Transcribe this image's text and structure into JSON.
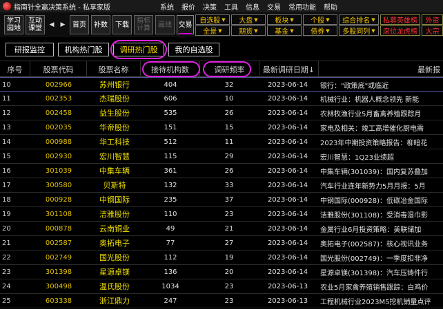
{
  "app": {
    "title": "指南针全赢决策系统 - 私享家版"
  },
  "menu": [
    "系统",
    "报价",
    "决策",
    "工具",
    "信息",
    "交易",
    "常用功能",
    "帮助"
  ],
  "toolbar": {
    "study_line1": "学习",
    "study_line2": "园地",
    "interact_line1": "互动",
    "interact_line2": "课堂",
    "home": "首页",
    "supplement": "补数",
    "download": "下载",
    "indicator_line1": "指标",
    "indicator_line2": "计算",
    "draw": "画线",
    "trade": "交易",
    "quick_row1": [
      "自选股",
      "大盘",
      "板块",
      "个股",
      "综合排名",
      "私募英雄榜",
      "外资"
    ],
    "quick_row2": [
      "全景",
      "期货",
      "基金",
      "债券",
      "多股同列",
      "席位龙虎榜",
      "大宗"
    ]
  },
  "tabs": [
    "研报监控",
    "机构热门股",
    "调研热门股",
    "我的自选股"
  ],
  "table": {
    "headers": [
      "序号",
      "股票代码",
      "股票名称",
      "接待机构数",
      "调研频率",
      "最新调研日期↓",
      "最新报"
    ],
    "rows": [
      {
        "no": "10",
        "code": "002966",
        "name": "苏州银行",
        "inst": "404",
        "freq": "32",
        "date": "2023-06-14",
        "report": "银行：\"政策底\"或临近"
      },
      {
        "no": "11",
        "code": "002353",
        "name": "杰瑞股份",
        "inst": "606",
        "freq": "10",
        "date": "2023-06-14",
        "report": "机械行业：机器人概念领先 新能"
      },
      {
        "no": "12",
        "code": "002458",
        "name": "益生股份",
        "inst": "535",
        "freq": "26",
        "date": "2023-06-14",
        "report": "农林牧渔行业5月畜禽养殖跟踪月"
      },
      {
        "no": "13",
        "code": "002035",
        "name": "华帝股份",
        "inst": "151",
        "freq": "15",
        "date": "2023-06-14",
        "report": "家电及相关：竣工高增催化厨电需"
      },
      {
        "no": "14",
        "code": "000988",
        "name": "华工科技",
        "inst": "512",
        "freq": "11",
        "date": "2023-06-14",
        "report": "2023年中期投资策略报告：柳暗花"
      },
      {
        "no": "15",
        "code": "002930",
        "name": "宏川智慧",
        "inst": "115",
        "freq": "29",
        "date": "2023-06-14",
        "report": "宏川智慧：1Q23业绩超"
      },
      {
        "no": "16",
        "code": "301039",
        "name": "中集车辆",
        "inst": "361",
        "freq": "26",
        "date": "2023-06-14",
        "report": "中集车辆(301039)：国内复苏叠加"
      },
      {
        "no": "17",
        "code": "300580",
        "name": "贝斯特",
        "inst": "132",
        "freq": "33",
        "date": "2023-06-14",
        "report": "汽车行业连年新势力5月月报：5月"
      },
      {
        "no": "18",
        "code": "000928",
        "name": "中钢国际",
        "inst": "235",
        "freq": "37",
        "date": "2023-06-14",
        "report": "中钢国际(000928)：低碳冶金国际"
      },
      {
        "no": "19",
        "code": "301108",
        "name": "洁雅股份",
        "inst": "110",
        "freq": "23",
        "date": "2023-06-14",
        "report": "洁雅股份(301108)：受消毒湿巾影"
      },
      {
        "no": "20",
        "code": "000878",
        "name": "云南铜业",
        "inst": "49",
        "freq": "21",
        "date": "2023-06-14",
        "report": "金属行业6月投资策略：美联储加"
      },
      {
        "no": "21",
        "code": "002587",
        "name": "奥拓电子",
        "inst": "77",
        "freq": "27",
        "date": "2023-06-14",
        "report": "奥拓电子(002587)：核心视讯业务"
      },
      {
        "no": "22",
        "code": "002749",
        "name": "国光股份",
        "inst": "112",
        "freq": "19",
        "date": "2023-06-14",
        "report": "国光股份(002749)：一季度扣非净"
      },
      {
        "no": "23",
        "code": "301398",
        "name": "星源卓镁",
        "inst": "136",
        "freq": "20",
        "date": "2023-06-14",
        "report": "星源卓镁(301398)：汽车压铸件行"
      },
      {
        "no": "24",
        "code": "300498",
        "name": "温氏股份",
        "inst": "1034",
        "freq": "23",
        "date": "2023-06-13",
        "report": "农业5月家禽养殖销售跟踪：白鸡价"
      },
      {
        "no": "25",
        "code": "603338",
        "name": "浙江鼎力",
        "inst": "247",
        "freq": "23",
        "date": "2023-06-13",
        "report": "工程机械行业2023M5挖机销量点评"
      }
    ]
  },
  "colors": {
    "accent_ring": "#e020e0",
    "code": "#e0c000",
    "name": "#f0e000",
    "active_tab": "#ffe000"
  }
}
